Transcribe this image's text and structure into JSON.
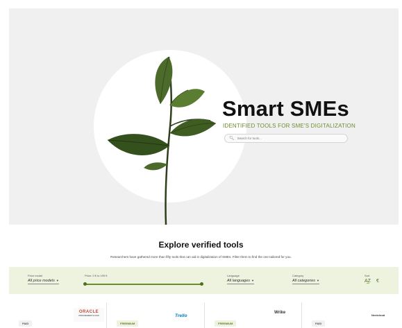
{
  "hero": {
    "title": "Smart SMEs",
    "subtitle": "IDENTIFIED TOOLS FOR SME'S DIGITALIZATION",
    "search_placeholder": "Search for tools...",
    "search_icon": "search-icon",
    "accent_color": "#6a8d2f"
  },
  "explore": {
    "title": "Explore verified tools",
    "description": "Researchers have gathered more than fifty tools that can aid in digitalization of SMEs. Filter them to find the one tailored for you."
  },
  "filters": {
    "price_model": {
      "label": "Price model",
      "value": "All price models"
    },
    "price": {
      "label": "Price: 0 € to 199 €",
      "min": 0,
      "max": 199
    },
    "language": {
      "label": "Language",
      "value": "All languages"
    },
    "category": {
      "label": "Category",
      "value": "All categories"
    },
    "sort": {
      "label": "Sort",
      "icons": [
        "sort-alpha-icon",
        "sort-price-icon"
      ],
      "alpha_glyph": "A͢Z",
      "price_glyph": "€"
    }
  },
  "tools": [
    {
      "badge": "PAID",
      "logo_line1": "ORACLE",
      "logo_line2": "PROCUREMENT CLOUD"
    },
    {
      "badge": "FREEMIUM",
      "logo_line1": "Trello"
    },
    {
      "badge": "FREEMIUM",
      "logo_line1": "Wrike"
    },
    {
      "badge": "PAID",
      "logo_line1": "Nextcloud"
    }
  ]
}
